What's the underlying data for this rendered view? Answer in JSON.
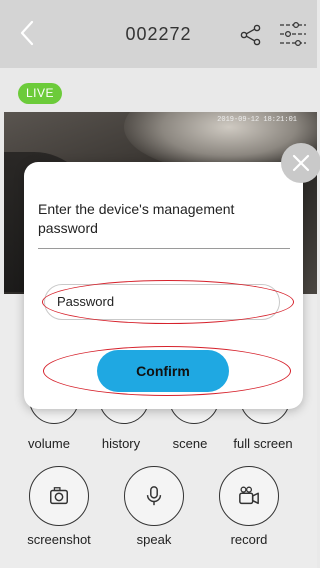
{
  "header": {
    "title": "002272",
    "back_icon": "chevron-left-icon",
    "share_icon": "share-icon",
    "settings_icon": "sliders-icon"
  },
  "live_badge": "LIVE",
  "video": {
    "timestamp": "2019-09-12 18:21:01"
  },
  "controls": [
    {
      "id": "volume",
      "label": "volume",
      "icon": "speaker-icon"
    },
    {
      "id": "history",
      "label": "history",
      "icon": "play-circle-icon"
    },
    {
      "id": "scene",
      "label": "scene",
      "icon": "scene-icon"
    },
    {
      "id": "fullscreen",
      "label": "full screen",
      "icon": "expand-icon"
    },
    {
      "id": "screenshot",
      "label": "screenshot",
      "icon": "camera-icon"
    },
    {
      "id": "speak",
      "label": "speak",
      "icon": "microphone-icon"
    },
    {
      "id": "record",
      "label": "record",
      "icon": "video-camera-icon"
    }
  ],
  "dialog": {
    "message": "Enter the device's management password",
    "password_placeholder": "Password",
    "confirm_label": "Confirm",
    "close_icon": "close-icon"
  },
  "colors": {
    "header_bg": "#d4d4d4",
    "live_green": "#6ccb3a",
    "confirm_blue": "#1fa8e2",
    "highlight_red": "#d6222c"
  }
}
